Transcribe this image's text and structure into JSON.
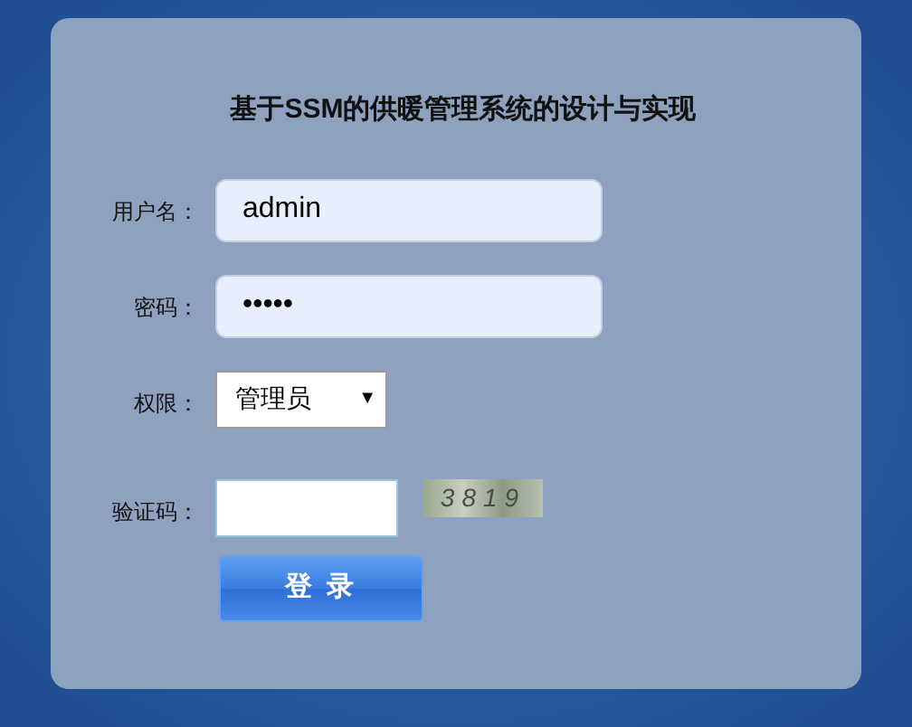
{
  "title": "基于SSM的供暖管理系统的设计与实现",
  "fields": [
    {
      "kind": "text",
      "label": "用户名：",
      "value": "admin"
    },
    {
      "kind": "password",
      "label": "密码：",
      "value": "•••••"
    },
    {
      "kind": "select",
      "label": "权限：",
      "value": "管理员",
      "arrow": "▼"
    },
    {
      "kind": "captcha",
      "label": "验证码：",
      "code": "3819"
    }
  ],
  "button": "登 录"
}
